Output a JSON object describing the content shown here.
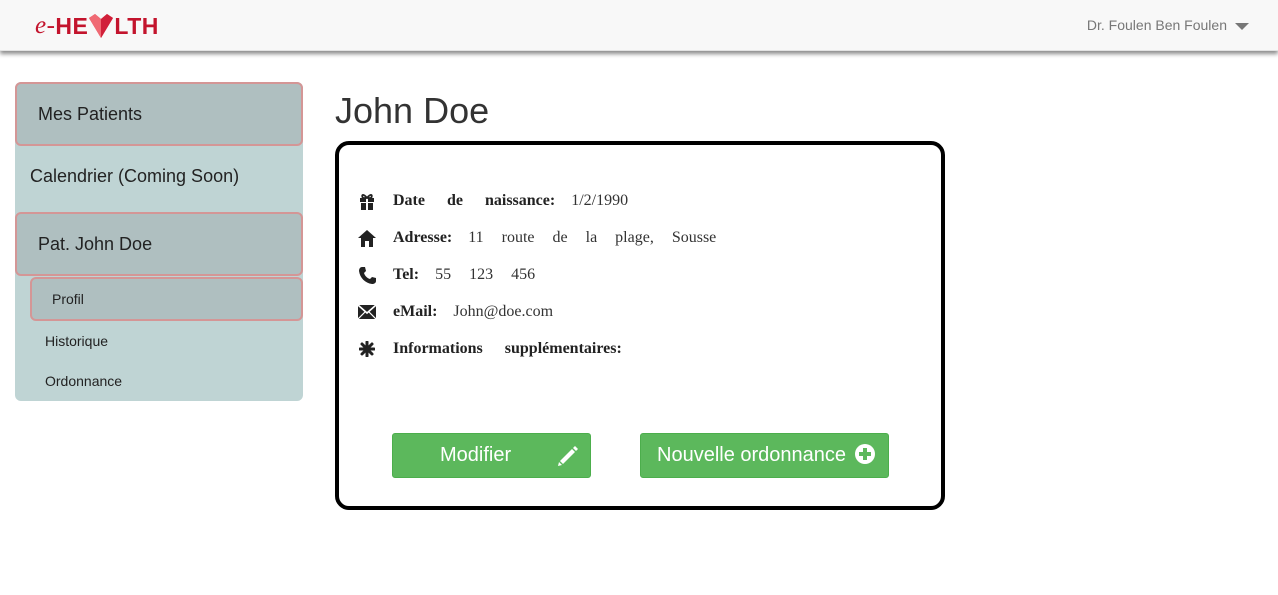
{
  "header": {
    "logo_prefix": "e-",
    "logo_part1": "HE",
    "logo_part2": "LTH",
    "user_name": "Dr. Foulen Ben Foulen",
    "brand_color": "#c3142d"
  },
  "sidebar": {
    "items": [
      {
        "label": "Mes Patients"
      },
      {
        "label": "Calendrier (Coming Soon)"
      },
      {
        "label": "Pat. John Doe"
      },
      {
        "label": "Profil"
      },
      {
        "label": "Historique"
      },
      {
        "label": "Ordonnance"
      }
    ]
  },
  "main": {
    "title": "John Doe",
    "fields": [
      {
        "icon": "gift-icon",
        "label": "Date de naissance:",
        "value": "1/2/1990"
      },
      {
        "icon": "home-icon",
        "label": "Adresse:",
        "value": "11 route de la plage, Sousse"
      },
      {
        "icon": "phone-icon",
        "label": "Tel:",
        "value": "55 123 456"
      },
      {
        "icon": "envelope-icon",
        "label": "eMail:",
        "value": "John@doe.com"
      },
      {
        "icon": "asterisk-icon",
        "label": "Informations supplémentaires:",
        "value": ""
      }
    ],
    "buttons": {
      "edit_label": "Modifier",
      "new_prescription_label": "Nouvelle ordonnance"
    }
  },
  "colors": {
    "sidebar_bg": "#bfd4d4",
    "sidebar_active_bg": "#afbfc0",
    "sidebar_active_border": "#d49696",
    "button_green": "#5cb85c"
  }
}
